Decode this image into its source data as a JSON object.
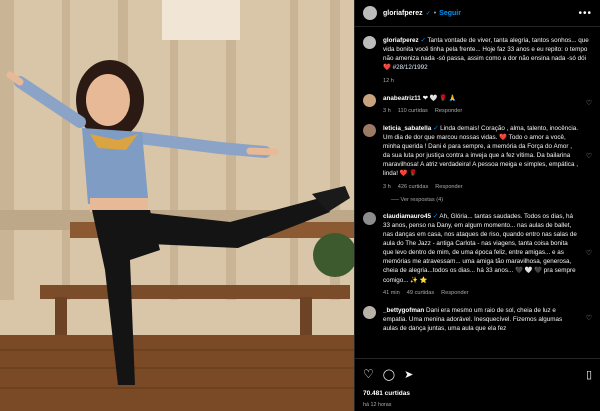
{
  "post": {
    "username": "gloriafperez",
    "verified_mark": "✓",
    "follow_label": "Seguir",
    "more_label": "•••"
  },
  "caption": {
    "username": "gloriafperez",
    "text": "Tanta vontade de viver, tanta alegria, tantos sonhos... que vida bonita você tinha pela frente... Hoje faz 33 anos e eu repito: o tempo não ameniza nada -só passa, assim como a dor não ensina nada -só dói",
    "heart": "❤️",
    "hashtag": "#28/12/1992",
    "time": "12 h"
  },
  "comments": [
    {
      "username": "anabeatriz11",
      "text": "❤ 🤍 🌹 🙏",
      "time": "3 h",
      "likes": "110 curtidas",
      "reply": "Responder"
    },
    {
      "username": "leticia_sabatella",
      "text": "Linda demais! Coração , alma, talento, inocência. Um dia de dor que marcou nossas vidas. ❤️ Todo o amor a você, minha querida ! Dani é para sempre, a memória da Força do Amor , da sua luta por justiça contra a inveja que a fez vítima. Da bailarina maravilhosa! A atriz verdadeira! A pessoa meiga e simples, empática , linda! ❤️ 🌹",
      "time": "3 h",
      "likes": "426 curtidas",
      "reply": "Responder",
      "view_replies": "Ver respostas (4)"
    },
    {
      "username": "claudiamauro45",
      "text": "Ah, Glória... tantas saudades. Todos os dias, há 33 anos, penso na Dany, em algum momento... nas aulas de ballet, nas danças em casa, nos ataques de riso, quando entro nas salas de aula do The Jazz - antiga Carlota - nas viagens, tanta coisa bonita que levo dentro de mim, de uma época feliz, entre amigas... e as memórias me atravessam... uma amiga tão maravilhosa, generosa, cheia de alegria...todos os dias... há 33 anos... 🖤 🤍 🖤 pra sempre comigo... ✨ ⭐",
      "time": "41 min",
      "likes": "49 curtidas",
      "reply": "Responder"
    },
    {
      "username": "_bettygofman",
      "text": "Dani era mesmo um raio de sol, cheia de luz e empatia. Uma menina adorável. Inesquecível. Fizemos algumas aulas de dança juntas, uma aula que ela fez",
      "time": "",
      "likes": "",
      "reply": ""
    }
  ],
  "footer": {
    "likes": "70.481 curtidas",
    "time": "há 12 horas"
  },
  "icons": [
    "heart-icon",
    "comment-icon",
    "share-icon",
    "bookmark-icon",
    "more-icon",
    "verified-icon"
  ],
  "colors": {
    "accent": "#0095f6",
    "like": "#ed4956",
    "background": "#000000",
    "muted": "#a8a8a8"
  }
}
